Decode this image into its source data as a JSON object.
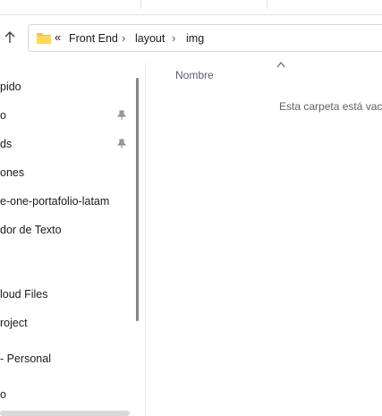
{
  "breadcrumb": {
    "overflow": "«",
    "items": [
      "Front End",
      "layout",
      "img"
    ]
  },
  "sidebar": {
    "items": [
      {
        "label": "pido",
        "pinned": false
      },
      {
        "label": "o",
        "pinned": true
      },
      {
        "label": "ds",
        "pinned": true
      },
      {
        "label": "ones",
        "pinned": false
      },
      {
        "label": "e-one-portafolio-latam",
        "pinned": false
      },
      {
        "label": "dor de Texto",
        "pinned": false
      },
      {
        "label": "loud Files",
        "pinned": false
      },
      {
        "label": "roject",
        "pinned": false
      },
      {
        "label": "- Personal",
        "pinned": false
      },
      {
        "label": "o",
        "pinned": false
      }
    ]
  },
  "content": {
    "column_name": "Nombre",
    "empty_message": "Esta carpeta está vacía."
  },
  "icons": {
    "up": "arrow-up-icon",
    "folder": "folder-icon",
    "pin": "pin-icon",
    "chevron": "chevron-right-icon",
    "sort": "sort-up-icon"
  },
  "colors": {
    "folder": "#f5c242",
    "header_text": "#5a5a7a",
    "scrollbar": "#858585"
  }
}
